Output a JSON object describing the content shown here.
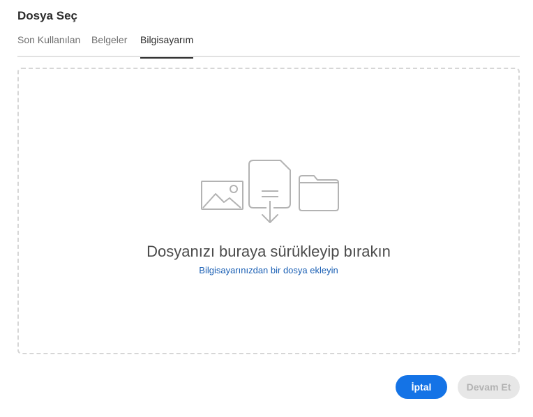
{
  "dialog": {
    "title": "Dosya Seç"
  },
  "tabs": [
    {
      "label": "Son Kullanılan",
      "selected": false
    },
    {
      "label": "Belgeler",
      "selected": false
    },
    {
      "label": "Bilgisayarım",
      "selected": true
    }
  ],
  "dropzone": {
    "main_text": "Dosyanızı buraya sürükleyip bırakın",
    "link_text": "Bilgisayarınızdan bir dosya ekleyin",
    "icons": [
      "image-icon",
      "document-download-icon",
      "folder-icon"
    ]
  },
  "buttons": {
    "cancel_label": "İptal",
    "continue_label": "Devam Et",
    "continue_disabled": true
  },
  "colors": {
    "accent": "#1473e6",
    "link": "#1a5fb4",
    "icon_gray": "#b3b3b3",
    "disabled_bg": "#e7e7e7"
  }
}
